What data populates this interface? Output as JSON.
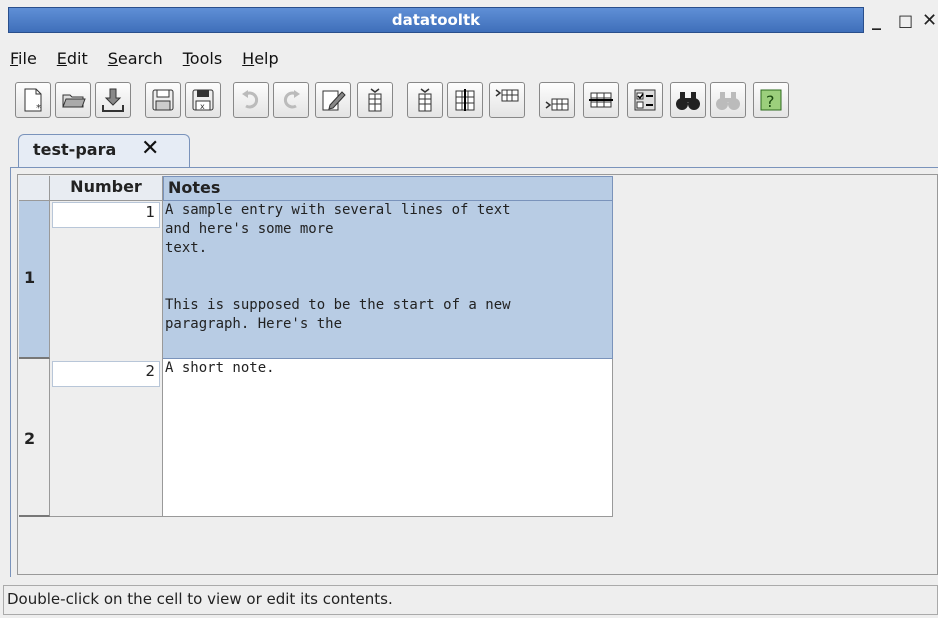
{
  "window": {
    "title": "datatooltk",
    "minimize_label": "_",
    "maximize_label": "□",
    "close_label": "✕"
  },
  "menubar": {
    "items": [
      {
        "label": "File",
        "mnemonic": "F",
        "rest": "ile"
      },
      {
        "label": "Edit",
        "mnemonic": "E",
        "rest": "dit"
      },
      {
        "label": "Search",
        "mnemonic": "S",
        "rest": "earch"
      },
      {
        "label": "Tools",
        "mnemonic": "T",
        "rest": "ools"
      },
      {
        "label": "Help",
        "mnemonic": "H",
        "rest": "elp"
      }
    ]
  },
  "toolbar": {
    "buttons": [
      {
        "icon": "new-document-icon"
      },
      {
        "icon": "open-folder-icon"
      },
      {
        "icon": "import-icon"
      },
      {
        "icon": "save-icon"
      },
      {
        "icon": "save-as-icon"
      },
      {
        "icon": "undo-icon"
      },
      {
        "icon": "redo-icon"
      },
      {
        "icon": "edit-cell-icon"
      },
      {
        "icon": "insert-column-before-icon"
      },
      {
        "icon": "insert-column-after-icon"
      },
      {
        "icon": "column-icon"
      },
      {
        "icon": "insert-row-before-icon"
      },
      {
        "icon": "insert-row-after-icon"
      },
      {
        "icon": "delete-row-icon"
      },
      {
        "icon": "properties-icon"
      },
      {
        "icon": "find-icon"
      },
      {
        "icon": "find-next-icon"
      },
      {
        "icon": "help-icon"
      }
    ]
  },
  "tabs": [
    {
      "label": "test-para",
      "close": "✕"
    }
  ],
  "table": {
    "columns": [
      "Number",
      "Notes"
    ],
    "rows": [
      {
        "row_label": "1",
        "number": "1",
        "notes": "A sample entry with several lines of text\nand here's some more\ntext.\n\n\nThis is supposed to be the start of a new\nparagraph. Here's the",
        "selected": true
      },
      {
        "row_label": "2",
        "number": "2",
        "notes": "A short note.",
        "selected": false
      }
    ]
  },
  "status_bar": {
    "text": "Double-click on the cell to view or edit its contents."
  },
  "colors": {
    "title_bar": "#4a7cc8",
    "selection": "#b8cce4",
    "row_header_selected": "#b8cce4"
  }
}
